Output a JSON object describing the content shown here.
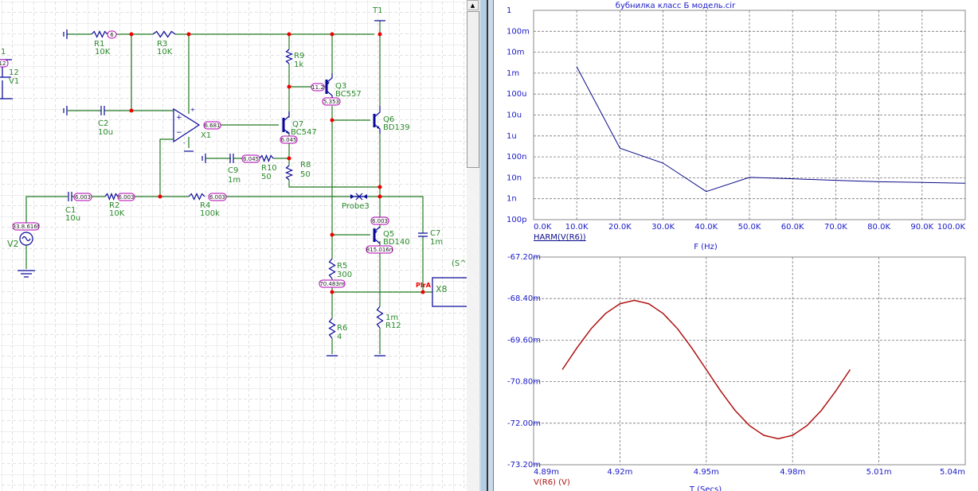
{
  "schematic": {
    "components": {
      "R1": {
        "name": "R1",
        "value": "10K"
      },
      "R3": {
        "name": "R3",
        "value": "10K"
      },
      "R2": {
        "name": "R2",
        "value": "10K"
      },
      "R4": {
        "name": "R4",
        "value": "100k"
      },
      "R5": {
        "name": "R5",
        "value": "300"
      },
      "R6": {
        "name": "R6",
        "value": "4"
      },
      "R8": {
        "name": "R8",
        "value": "50"
      },
      "R9": {
        "name": "R9",
        "value": "1k"
      },
      "R10": {
        "name": "R10",
        "value": "50"
      },
      "R12": {
        "name": "R12",
        "value": "1m"
      },
      "C1": {
        "name": "C1",
        "value": "10u"
      },
      "C2": {
        "name": "C2",
        "value": "10u"
      },
      "C7": {
        "name": "C7",
        "value": "1m"
      },
      "C9": {
        "name": "C9",
        "value": "1m"
      },
      "Q3": {
        "name": "Q3",
        "model": "BC557"
      },
      "Q5": {
        "name": "Q5",
        "model": "BD140"
      },
      "Q6": {
        "name": "Q6",
        "model": "BD139"
      },
      "Q7": {
        "name": "Q7",
        "model": "BC547"
      },
      "X1": {
        "name": "X1"
      },
      "X8": {
        "name": "X8",
        "pin": "PIrA",
        "partial_text": "(S^"
      },
      "V1": {
        "name": "V1",
        "value": "12",
        "partial_label": "1"
      },
      "V2": {
        "name": "V2"
      },
      "T1": {
        "name": "T1"
      },
      "Probe3": {
        "name": "Probe3"
      }
    },
    "node_voltages": {
      "r1": "6",
      "v1": "12",
      "x1_out": "6.681",
      "c1": "6.003",
      "r2": "6.003",
      "r4": "6.003",
      "v2": "33.8.616f",
      "q3_b": "11.2",
      "q3_e": "5.353",
      "q7_e": "6.045",
      "c9": "6.045",
      "q5_top": "6.003",
      "q5_bot": "815.016n",
      "r5": "70.483m"
    },
    "colors": {
      "wire": "#237a23",
      "component": "#0a0a9a",
      "node": "#e00000",
      "label": "#2a8a2a",
      "voltage_tag": "#b000b0"
    }
  },
  "scrollbar": {
    "up_icon": "▲"
  },
  "plots": {
    "file_title": "бубнилка класс Б модель.cir"
  },
  "chart_data": [
    {
      "type": "line",
      "title": "бубнилка класс Б модель.cir",
      "xlabel": "F (Hz)",
      "ylabel": "",
      "series": [
        {
          "name": "HARM(V(R6))",
          "color": "#0a0a8a",
          "x": [
            10000,
            20000,
            30000,
            40000,
            50000,
            60000,
            70000,
            80000,
            90000,
            100000
          ],
          "y": [
            0.002,
            2.6e-07,
            5e-08,
            2.2e-09,
            1.05e-08,
            9e-09,
            7.5e-09,
            6.5e-09,
            6e-09,
            5.5e-09
          ]
        }
      ],
      "xlim": [
        0,
        100000
      ],
      "ylim": [
        1e-10,
        1
      ],
      "yscale": "log",
      "xticks": [
        "0.0K",
        "10.0K",
        "20.0K",
        "30.0K",
        "40.0K",
        "50.0K",
        "60.0K",
        "70.0K",
        "80.0K",
        "90.0K",
        "100.0K"
      ],
      "yticks": [
        "1",
        "100m",
        "10m",
        "1m",
        "100u",
        "10u",
        "1u",
        "100n",
        "10n",
        "1n",
        "100p"
      ],
      "grid": true
    },
    {
      "type": "line",
      "xlabel": "T (Secs)",
      "ylabel": "",
      "series": [
        {
          "name": "V(R6) (V)",
          "color": "#b01010",
          "x": [
            4.9,
            4.905,
            4.91,
            4.915,
            4.92,
            4.925,
            4.93,
            4.935,
            4.94,
            4.945,
            4.95,
            4.955,
            4.96,
            4.965,
            4.97,
            4.975,
            4.98,
            4.985,
            4.99,
            4.995,
            5.0
          ],
          "y": [
            -70.45,
            -69.83,
            -69.27,
            -68.83,
            -68.55,
            -68.45,
            -68.55,
            -68.83,
            -69.27,
            -69.83,
            -70.45,
            -71.07,
            -71.63,
            -72.07,
            -72.35,
            -72.45,
            -72.35,
            -72.07,
            -71.63,
            -71.07,
            -70.45
          ]
        }
      ],
      "x_unit": "ms",
      "y_unit": "mV",
      "xlim": [
        4.89,
        5.04
      ],
      "ylim": [
        -73.2,
        -67.2
      ],
      "xticks": [
        "4.89m",
        "4.92m",
        "4.95m",
        "4.98m",
        "5.01m",
        "5.04m"
      ],
      "yticks": [
        "-67.20m",
        "-68.40m",
        "-69.60m",
        "-70.80m",
        "-72.00m",
        "-73.20m"
      ],
      "grid": true
    }
  ]
}
